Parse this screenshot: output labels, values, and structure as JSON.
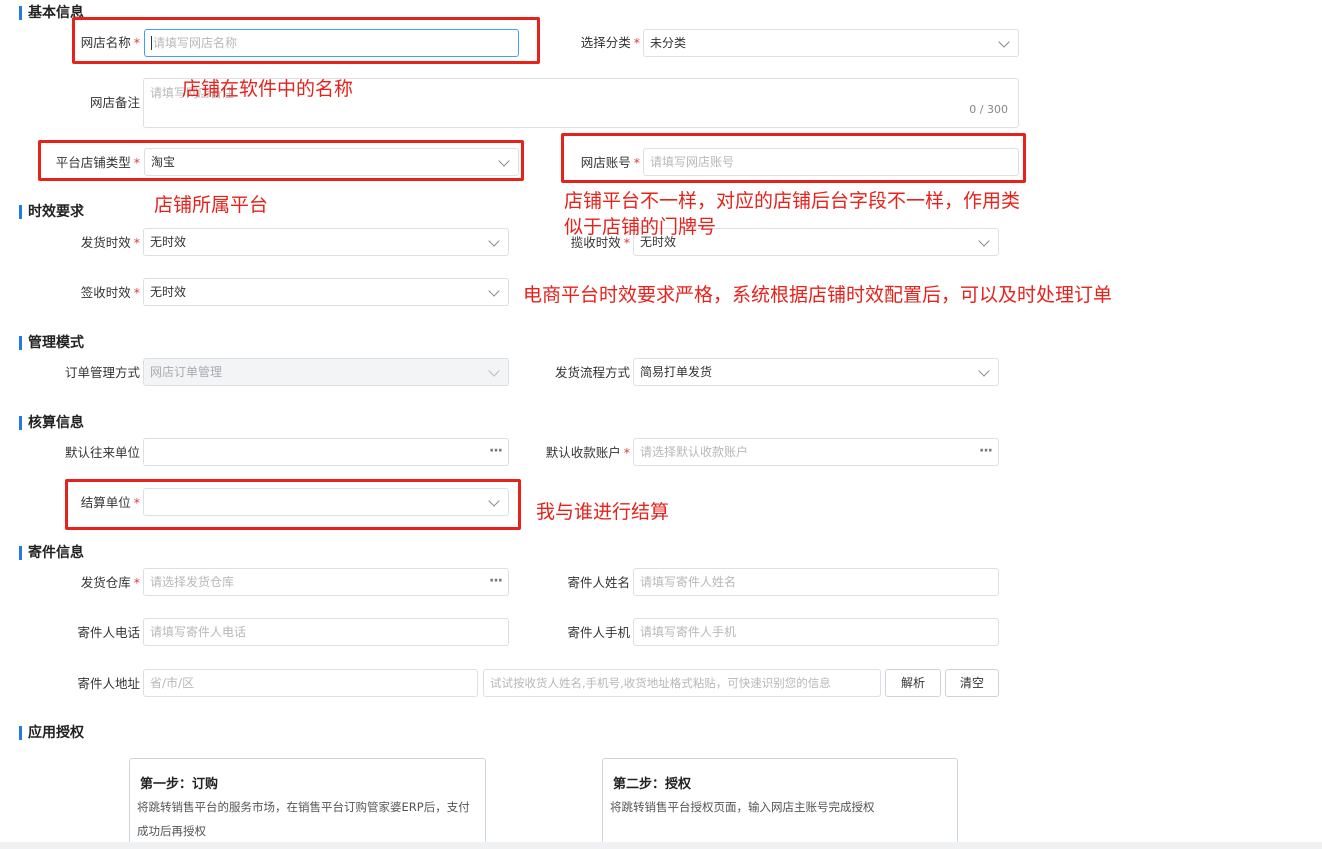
{
  "sections": {
    "basic": "基本信息",
    "timeliness": "时效要求",
    "management": "管理模式",
    "accounting": "核算信息",
    "sender": "寄件信息",
    "authorization": "应用授权"
  },
  "fields": {
    "store_name": {
      "label": "网店名称",
      "placeholder": "请填写网店名称"
    },
    "category": {
      "label": "选择分类",
      "value": "未分类"
    },
    "remark": {
      "label": "网店备注",
      "placeholder": "请填写网店备注",
      "counter": "0 / 300"
    },
    "platform_type": {
      "label": "平台店铺类型",
      "value": "淘宝"
    },
    "store_account": {
      "label": "网店账号",
      "placeholder": "请填写网店账号"
    },
    "ship_time": {
      "label": "发货时效",
      "value": "无时效"
    },
    "pickup_time": {
      "label": "揽收时效",
      "value": "无时效"
    },
    "sign_time": {
      "label": "签收时效",
      "value": "无时效"
    },
    "order_mode": {
      "label": "订单管理方式",
      "value": "网店订单管理"
    },
    "ship_flow": {
      "label": "发货流程方式",
      "value": "简易打单发货"
    },
    "default_partner": {
      "label": "默认往来单位",
      "value": ""
    },
    "default_account": {
      "label": "默认收款账户",
      "placeholder": "请选择默认收款账户"
    },
    "settle_unit": {
      "label": "结算单位",
      "value": ""
    },
    "warehouse": {
      "label": "发货仓库",
      "placeholder": "请选择发货仓库"
    },
    "sender_name": {
      "label": "寄件人姓名",
      "placeholder": "请填写寄件人姓名"
    },
    "sender_phone": {
      "label": "寄件人电话",
      "placeholder": "请填写寄件人电话"
    },
    "sender_mobile": {
      "label": "寄件人手机",
      "placeholder": "请填写寄件人手机"
    },
    "sender_address": {
      "label": "寄件人地址",
      "placeholder": "省/市/区",
      "paste_placeholder": "试试按收货人姓名,手机号,收货地址格式粘贴，可快速识别您的信息"
    }
  },
  "buttons": {
    "parse": "解析",
    "clear": "清空"
  },
  "cards": [
    {
      "title": "第一步：订购",
      "desc": "将跳转销售平台的服务市场，在销售平台订购管家婆ERP后，支付成功后再授权"
    },
    {
      "title": "第二步：授权",
      "desc": "将跳转销售平台授权页面，输入网店主账号完成授权"
    }
  ],
  "annotations": {
    "store_name_note": "店铺在软件中的名称",
    "platform_note": "店铺所属平台",
    "account_note": "店铺平台不一样，对应的店铺后台字段不一样，作用类似于店铺的门牌号",
    "timeliness_note": "电商平台时效要求严格，系统根据店铺时效配置后，可以及时处理订单",
    "settle_note": "我与谁进行结算"
  },
  "colors": {
    "accent": "#1e7ce8",
    "annotation": "#e7221b",
    "required": "#e53935"
  }
}
